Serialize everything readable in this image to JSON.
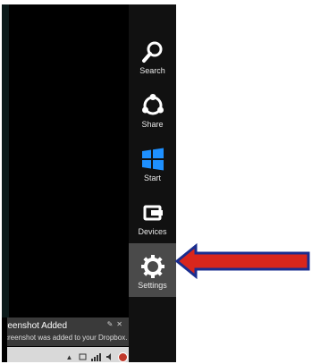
{
  "charms": [
    {
      "label": "Search",
      "icon": "search-icon"
    },
    {
      "label": "Share",
      "icon": "share-icon"
    },
    {
      "label": "Start",
      "icon": "windows-start-icon"
    },
    {
      "label": "Devices",
      "icon": "devices-icon"
    },
    {
      "label": "Settings",
      "icon": "gear-icon",
      "selected": true
    }
  ],
  "toast": {
    "title": "reenshot Added",
    "body": "creenshot was added to your Dropbox."
  },
  "colors": {
    "charm_bar": "#111111",
    "selected_charm": "#4a4a4a",
    "start_blue": "#1e90ff",
    "arrow_fill": "#d9261c",
    "arrow_outline": "#1a2d8f"
  }
}
